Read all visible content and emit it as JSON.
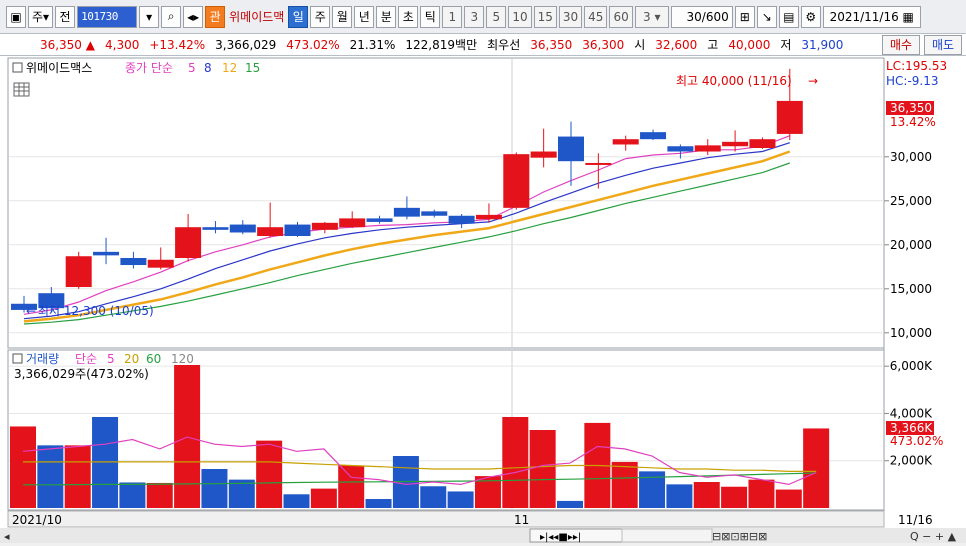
{
  "toolbar": {
    "market": "주",
    "prev": "전",
    "code": "101730",
    "tag": "관",
    "name": "위메이드맥",
    "periods": [
      "일",
      "주",
      "월",
      "년",
      "분",
      "초",
      "틱"
    ],
    "active_period": "일",
    "minutes": [
      "1",
      "3",
      "5",
      "10",
      "15",
      "30",
      "45",
      "60"
    ],
    "minute_select": "3",
    "count": "30/600",
    "date": "2021/11/16"
  },
  "quote": {
    "price": "36,350",
    "arrow": "▲",
    "change": "4,300",
    "change_rate": "+13.42%",
    "volume": "3,366,029",
    "volume_rate": "473.02%",
    "turnover": "21.31%",
    "amount": "122,819백만",
    "priority_label": "최우선",
    "ask": "36,350",
    "bid": "36,300",
    "open_label": "시",
    "open": "32,600",
    "high_label": "고",
    "high": "40,000",
    "low_label": "저",
    "low": "31,900",
    "buy_button": "매수",
    "sell_button": "매도"
  },
  "price_legend": {
    "name": "위메이드맥스",
    "ma_label": "종가 단순",
    "ma": [
      "5",
      "8",
      "12",
      "15"
    ]
  },
  "volume_legend": {
    "name": "거래량",
    "ma_label": "단순",
    "ma": [
      "5",
      "20",
      "60",
      "120"
    ],
    "current": "3,366,029주(473.02%)"
  },
  "annotations": {
    "high": "최고 40,000 (11/16)",
    "low": "최저 12,300 (10/05)"
  },
  "right_axis": {
    "lc": "LC:195.53",
    "hc": "HC:-9.13",
    "last_price": "36,350",
    "last_rate": "13.42%",
    "volume_last": "3,366K",
    "volume_rate": "473.02%"
  },
  "x_axis": {
    "start": "2021/10",
    "mid": "11",
    "end": "11/16"
  },
  "colors": {
    "up": "#e4121a",
    "down": "#1f57c8",
    "ma5": "#e040c0",
    "ma8": "#2a36c8",
    "ma12": "#f0a818",
    "ma15": "#27a040",
    "vma5": "#e040c0",
    "vma20": "#c8a000",
    "vma60": "#27a040"
  },
  "chart_data": {
    "type": "candlestick",
    "price_ticks": [
      "10,000",
      "15,000",
      "20,000",
      "25,000",
      "30,000"
    ],
    "price_tick_values": [
      10000,
      15000,
      20000,
      25000,
      30000
    ],
    "price_range": [
      8500,
      41000
    ],
    "volume_ticks": [
      "2,000K",
      "4,000K",
      "6,000K"
    ],
    "volume_tick_values": [
      2000,
      4000,
      6000
    ],
    "volume_range": [
      0,
      6600
    ],
    "candles": [
      {
        "o": 13300,
        "h": 14200,
        "l": 12300,
        "c": 12600
      },
      {
        "o": 14500,
        "h": 15200,
        "l": 12300,
        "c": 12800
      },
      {
        "o": 15200,
        "h": 19200,
        "l": 15000,
        "c": 18700
      },
      {
        "o": 19200,
        "h": 20800,
        "l": 17800,
        "c": 18800
      },
      {
        "o": 18500,
        "h": 19200,
        "l": 17300,
        "c": 17700
      },
      {
        "o": 17400,
        "h": 19700,
        "l": 17200,
        "c": 18300
      },
      {
        "o": 18500,
        "h": 23500,
        "l": 18100,
        "c": 22000
      },
      {
        "o": 22000,
        "h": 22700,
        "l": 21300,
        "c": 21700
      },
      {
        "o": 22300,
        "h": 22800,
        "l": 21200,
        "c": 21400
      },
      {
        "o": 21000,
        "h": 24800,
        "l": 20800,
        "c": 22000
      },
      {
        "o": 22300,
        "h": 22600,
        "l": 20900,
        "c": 21000
      },
      {
        "o": 21700,
        "h": 22600,
        "l": 21300,
        "c": 22500
      },
      {
        "o": 22000,
        "h": 23800,
        "l": 21900,
        "c": 23000
      },
      {
        "o": 23000,
        "h": 23300,
        "l": 22400,
        "c": 22600
      },
      {
        "o": 24200,
        "h": 25500,
        "l": 22900,
        "c": 23200
      },
      {
        "o": 23800,
        "h": 24000,
        "l": 23100,
        "c": 23300
      },
      {
        "o": 23300,
        "h": 23500,
        "l": 21900,
        "c": 22400
      },
      {
        "o": 22900,
        "h": 24700,
        "l": 22500,
        "c": 23400
      },
      {
        "o": 24200,
        "h": 30500,
        "l": 24000,
        "c": 30300
      },
      {
        "o": 29900,
        "h": 33200,
        "l": 28800,
        "c": 30600
      },
      {
        "o": 32300,
        "h": 34000,
        "l": 26700,
        "c": 29500
      },
      {
        "o": 29100,
        "h": 30400,
        "l": 26400,
        "c": 29300
      },
      {
        "o": 31400,
        "h": 32400,
        "l": 30700,
        "c": 32000
      },
      {
        "o": 32800,
        "h": 33100,
        "l": 31900,
        "c": 32000
      },
      {
        "o": 31200,
        "h": 31400,
        "l": 29800,
        "c": 30600
      },
      {
        "o": 30600,
        "h": 32000,
        "l": 30200,
        "c": 31300
      },
      {
        "o": 31200,
        "h": 33000,
        "l": 30600,
        "c": 31700
      },
      {
        "o": 31000,
        "h": 32200,
        "l": 30900,
        "c": 32000
      },
      {
        "o": 32600,
        "h": 40000,
        "l": 31900,
        "c": 36350
      }
    ],
    "ma5": [
      12100,
      12600,
      13500,
      14800,
      15800,
      16900,
      18200,
      19200,
      20000,
      20900,
      21400,
      21800,
      22000,
      22200,
      22300,
      22500,
      22600,
      22900,
      24400,
      26000,
      27300,
      28500,
      29800,
      30200,
      30400,
      30800,
      30800,
      31200,
      32400
    ],
    "ma8": [
      11600,
      11900,
      12400,
      13300,
      14100,
      15000,
      16100,
      17300,
      18300,
      19300,
      20100,
      20800,
      21300,
      21700,
      22000,
      22200,
      22400,
      22600,
      23600,
      24800,
      25900,
      27000,
      27900,
      28700,
      29300,
      29900,
      30300,
      30600,
      31600
    ],
    "ma12": [
      11300,
      11600,
      12000,
      12600,
      13200,
      13800,
      14600,
      15500,
      16300,
      17200,
      18000,
      18800,
      19500,
      20100,
      20600,
      21100,
      21500,
      21900,
      22700,
      23500,
      24300,
      25100,
      25900,
      26700,
      27400,
      28100,
      28800,
      29500,
      30600
    ],
    "ma15": [
      11000,
      11200,
      11500,
      12000,
      12500,
      13000,
      13600,
      14300,
      15000,
      15700,
      16500,
      17200,
      17900,
      18500,
      19100,
      19700,
      20300,
      20900,
      21600,
      22400,
      23100,
      23900,
      24700,
      25400,
      26100,
      26800,
      27500,
      28200,
      29300
    ],
    "volumes": [
      3450,
      2650,
      2650,
      3850,
      1080,
      1060,
      6050,
      1650,
      1200,
      2850,
      580,
      820,
      1800,
      380,
      2200,
      920,
      700,
      1350,
      3850,
      3300,
      300,
      3600,
      1950,
      1550,
      1000,
      1100,
      900,
      1200,
      780,
      3366
    ],
    "vma5": [
      2400,
      2500,
      2600,
      2700,
      2900,
      2500,
      3000,
      2700,
      2600,
      2700,
      2400,
      2500,
      1300,
      1200,
      1000,
      1100,
      1000,
      1300,
      1500,
      1800,
      1900,
      2600,
      2500,
      2200,
      1500,
      1300,
      1400,
      1200,
      1000,
      1500
    ],
    "vma20": [
      1950,
      1950,
      1950,
      1950,
      1950,
      1950,
      1950,
      1950,
      1950,
      1950,
      1900,
      1850,
      1800,
      1750,
      1700,
      1650,
      1650,
      1650,
      1700,
      1750,
      1800,
      1800,
      1750,
      1700,
      1650,
      1650,
      1600,
      1600,
      1550,
      1550
    ],
    "vma60": [
      980,
      980,
      990,
      1000,
      1000,
      1010,
      1020,
      1030,
      1040,
      1060,
      1080,
      1090,
      1100,
      1110,
      1120,
      1130,
      1140,
      1150,
      1170,
      1200,
      1220,
      1240,
      1270,
      1300,
      1330,
      1360,
      1390,
      1420,
      1450,
      1480
    ]
  }
}
